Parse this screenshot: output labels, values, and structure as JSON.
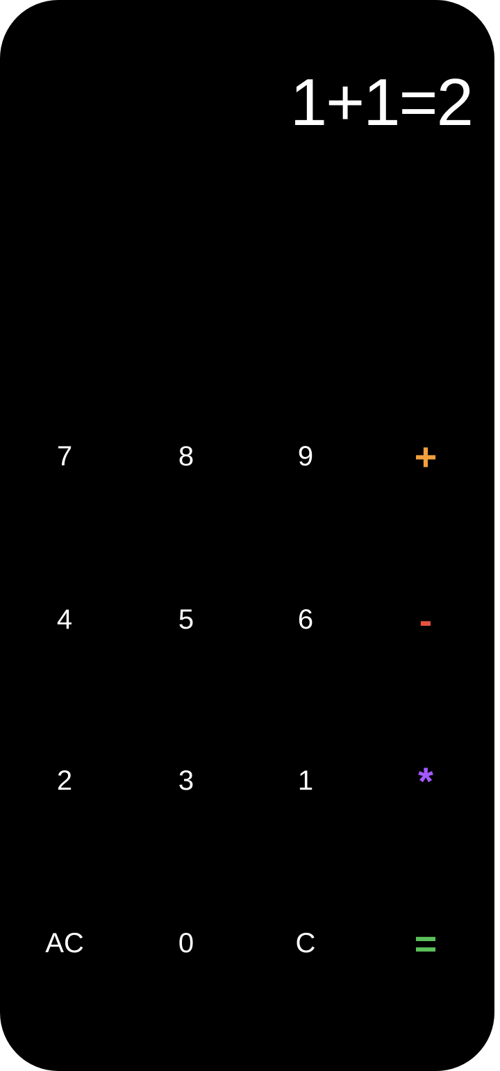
{
  "display": {
    "expression": "1+1=2"
  },
  "keypad": {
    "rows": [
      [
        "7",
        "8",
        "9",
        "+"
      ],
      [
        "4",
        "5",
        "6",
        "-"
      ],
      [
        "2",
        "3",
        "1",
        "*"
      ],
      [
        "AC",
        "0",
        "C",
        "="
      ]
    ]
  },
  "colors": {
    "background": "#000000",
    "digit_text": "#ffffff",
    "plus": "#f2a03d",
    "minus": "#e5533d",
    "multiply": "#a259ff",
    "equals": "#5bbf5a"
  }
}
